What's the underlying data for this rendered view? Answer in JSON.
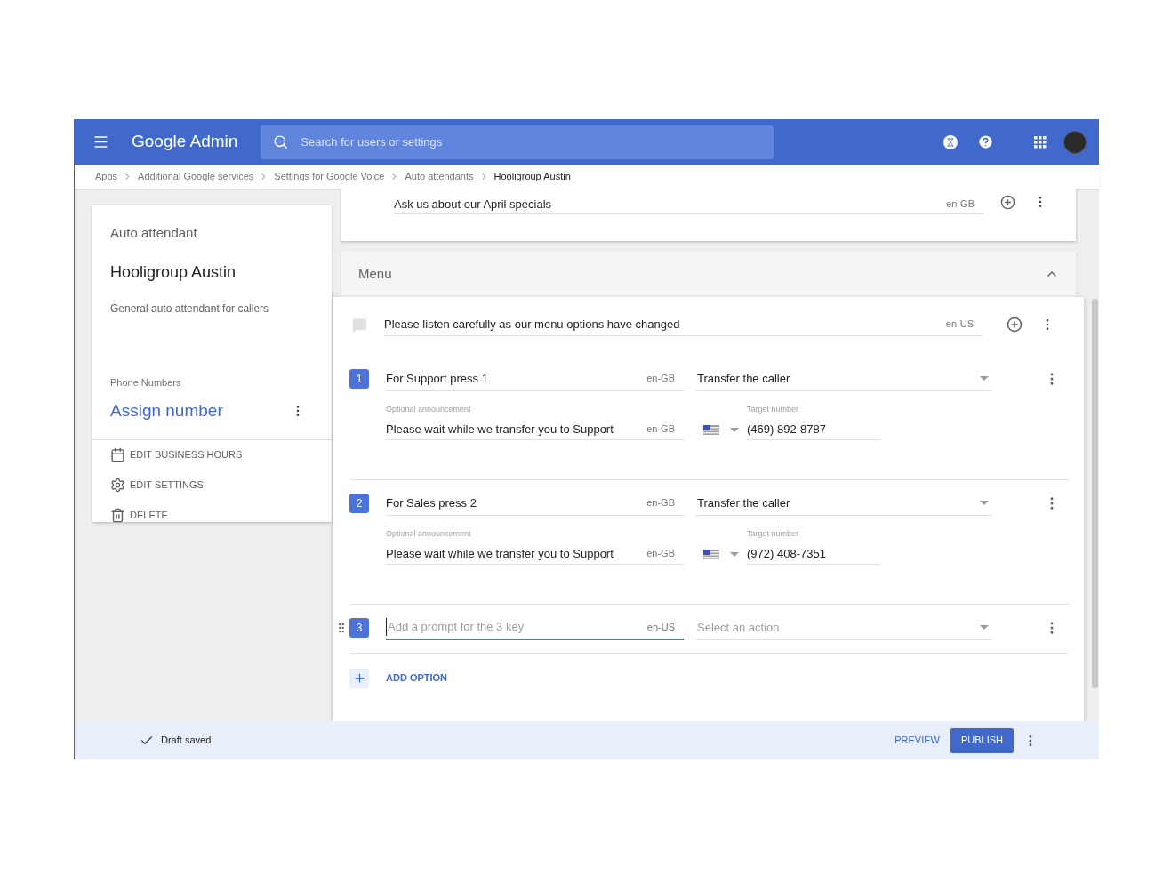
{
  "header": {
    "title": "Google Admin",
    "search_placeholder": "Search for users or settings"
  },
  "breadcrumbs": [
    {
      "label": "Apps",
      "current": false
    },
    {
      "label": "Additional Google services",
      "current": false
    },
    {
      "label": "Settings for Google Voice",
      "current": false
    },
    {
      "label": "Auto attendants",
      "current": false
    },
    {
      "label": "Hooligroup Austin",
      "current": true
    }
  ],
  "summary": {
    "label": "Auto attendant",
    "name": "Hooligroup Austin",
    "description": "General auto attendant for callers",
    "phone_label": "Phone Numbers",
    "assign_link": "Assign number",
    "actions": [
      {
        "kind": "calendar",
        "label": "EDIT BUSINESS HOURS"
      },
      {
        "kind": "settings",
        "label": "EDIT SETTINGS"
      },
      {
        "kind": "delete",
        "label": "DELETE"
      }
    ]
  },
  "top_prompt": {
    "text": "Ask us about our April specials",
    "lang": "en-GB"
  },
  "menu": {
    "title": "Menu",
    "expanded": true,
    "greeting": {
      "text": "Please listen carefully as our menu options have changed",
      "lang": "en-US"
    },
    "options": [
      {
        "key": "1",
        "prompt": "For Support press 1",
        "lang": "en-GB",
        "action": "Transfer the caller",
        "focused": false,
        "announcement_label": "Optional announcement",
        "announcement": "Please wait while we transfer you to Support",
        "announcement_lang": "en-GB",
        "target_label": "Target number",
        "target": "(469) 892-8787"
      },
      {
        "key": "2",
        "prompt": "For Sales press 2",
        "lang": "en-GB",
        "action": "Transfer the caller",
        "focused": false,
        "announcement_label": "Optional announcement",
        "announcement": "Please wait while we transfer you to Support",
        "announcement_lang": "en-GB",
        "target_label": "Target number",
        "target": "(972) 408-7351"
      },
      {
        "key": "3",
        "prompt_placeholder": "Add a prompt for the 3 key",
        "lang": "en-US",
        "action_placeholder": "Select an action",
        "focused": true
      }
    ],
    "add_label": "ADD OPTION"
  },
  "footer": {
    "status": "Draft saved",
    "preview": "PREVIEW",
    "publish": "PUBLISH"
  }
}
